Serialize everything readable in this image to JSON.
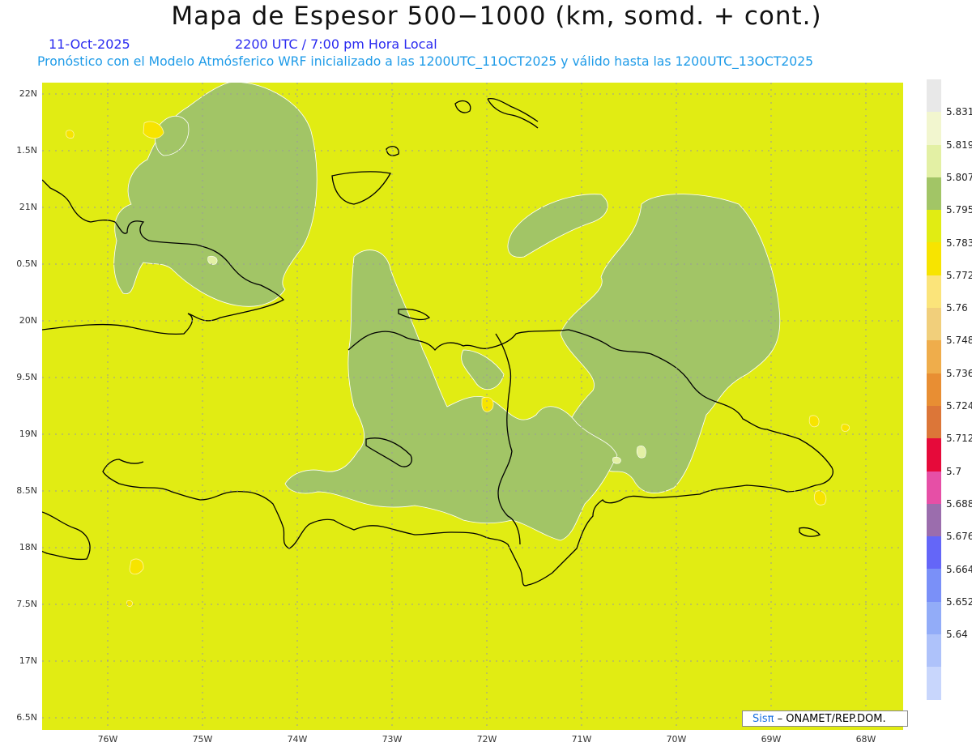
{
  "title": "Mapa de Espesor 500−1000 (km, somd. + cont.)",
  "date": "11-Oct-2025",
  "time": "2200 UTC / 7:00 pm Hora Local",
  "subtitle": "Pronóstico con el Modelo Atmósferico WRF inicializado a las 1200UTC_11OCT2025 y válido hasta las  1200UTC_13OCT2025",
  "credit": {
    "brand": "Sisπ",
    "text": " – ONAMET/REP.DOM."
  },
  "colors": {
    "background_field": "#e1ec13",
    "contour_green": "#a2c566",
    "coastline": "#000000"
  },
  "lat_labels": [
    "22N",
    "1.5N",
    "21N",
    "0.5N",
    "20N",
    "9.5N",
    "19N",
    "8.5N",
    "18N",
    "7.5N",
    "17N",
    "6.5N"
  ],
  "lon_labels": [
    "76W",
    "75W",
    "74W",
    "73W",
    "72W",
    "71W",
    "70W",
    "69W",
    "68W"
  ],
  "colorbar": {
    "labels": [
      "5.831",
      "5.819",
      "5.807",
      "5.795",
      "5.783",
      "5.772",
      "5.76",
      "5.748",
      "5.736",
      "5.724",
      "5.712",
      "5.7",
      "5.688",
      "5.676",
      "5.664",
      "5.652",
      "5.64"
    ],
    "colors": [
      "#e8e8e8",
      "#f2f6cf",
      "#e3f0a4",
      "#a2c566",
      "#e1ec13",
      "#f7e400",
      "#fbe47a",
      "#f1cf7b",
      "#efad4b",
      "#e88e33",
      "#dc7638",
      "#e60a3a",
      "#e64fa6",
      "#9b6dad",
      "#6466f8",
      "#7a90f8",
      "#92acf8",
      "#aec2fa",
      "#c8d6fc"
    ]
  }
}
